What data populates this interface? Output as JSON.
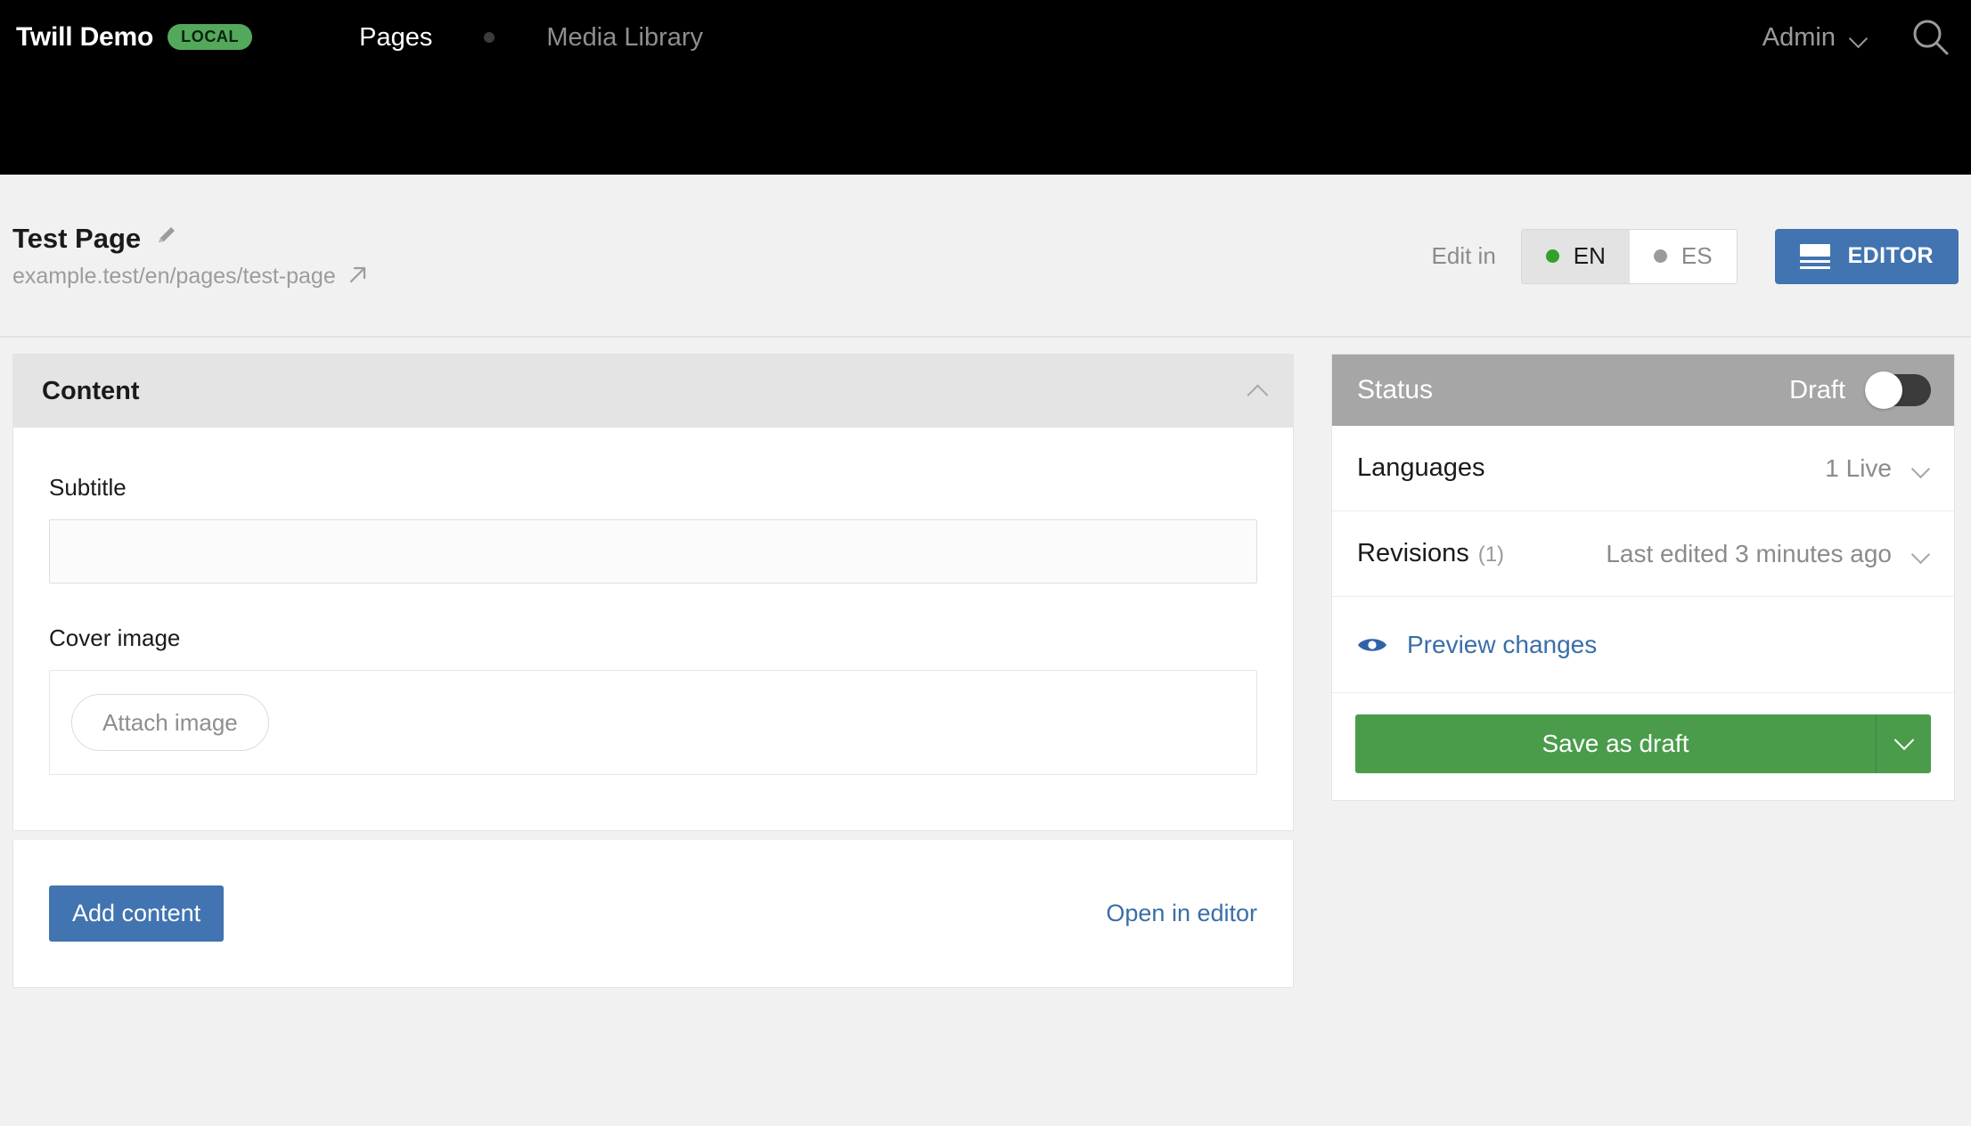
{
  "topnav": {
    "brand": "Twill Demo",
    "env_badge": "LOCAL",
    "links": [
      {
        "label": "Pages",
        "active": true
      },
      {
        "label": "Media Library",
        "active": false
      }
    ],
    "user_label": "Admin",
    "user_caret_icon": "chevron-down-icon",
    "search_icon": "search-icon",
    "background_color": "#000000",
    "badge_color": "#54a85c"
  },
  "titlebar": {
    "page_title": "Test Page",
    "edit_title_icon": "pencil-icon",
    "page_url": "example.test/en/pages/test-page",
    "external_link_icon": "external-link-arrow-icon",
    "edit_in_label": "Edit in",
    "languages": [
      {
        "code": "EN",
        "active": true,
        "published": true
      },
      {
        "code": "ES",
        "active": false,
        "published": false
      }
    ],
    "editor_button_label": "EDITOR",
    "editor_button_icon": "layout-editor-icon",
    "editor_button_color": "#4174b0",
    "active_lang_dot_color": "#33a02c",
    "inactive_lang_dot_color": "#9b9b9b"
  },
  "content_panel": {
    "header_title": "Content",
    "collapse_icon": "chevron-up-icon",
    "fields": [
      {
        "label": "Subtitle",
        "type": "text",
        "value": "",
        "placeholder": ""
      },
      {
        "label": "Cover image",
        "type": "media",
        "attach_label": "Attach image"
      }
    ],
    "footer": {
      "add_content_label": "Add content",
      "add_content_color": "#4174b0",
      "open_in_editor_label": "Open in editor",
      "open_in_editor_color": "#3a6ea8"
    }
  },
  "sidebar": {
    "status": {
      "title": "Status",
      "toggle_label": "Draft",
      "toggle_on": false,
      "header_color": "#a6a6a6"
    },
    "rows": [
      {
        "label": "Languages",
        "count": "",
        "value": "1 Live",
        "caret_icon": "chevron-down-icon"
      },
      {
        "label": "Revisions",
        "count": "(1)",
        "value": "Last edited 3 minutes ago",
        "caret_icon": "chevron-down-icon"
      }
    ],
    "preview": {
      "label": "Preview changes",
      "icon": "eye-icon",
      "color": "#3a6ea8"
    },
    "save": {
      "label": "Save as draft",
      "color": "#4a9c4a",
      "caret_icon": "chevron-down-icon"
    }
  }
}
